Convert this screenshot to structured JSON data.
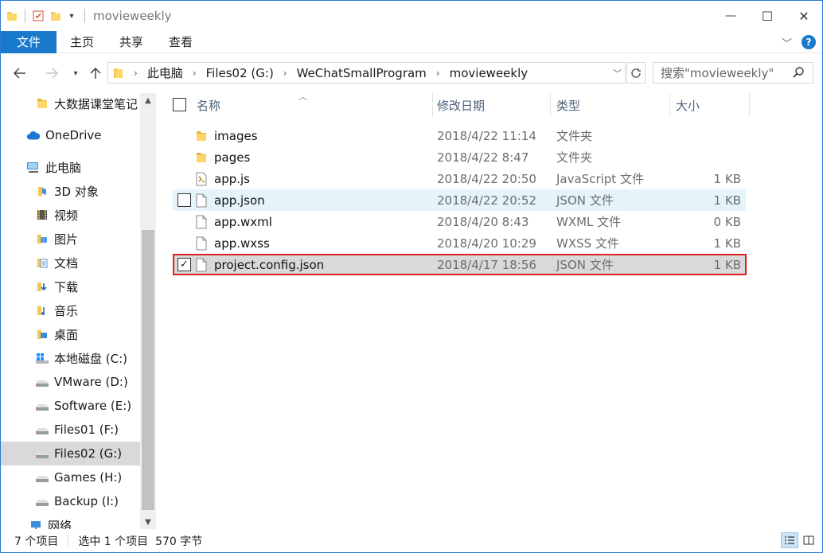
{
  "window": {
    "title": "movieweekly",
    "controls": {
      "minimize": "—",
      "maximize": "☐",
      "close": "✕"
    }
  },
  "ribbon": {
    "file_tab": "文件",
    "tabs": [
      "主页",
      "共享",
      "查看"
    ]
  },
  "address": {
    "breadcrumbs": [
      "此电脑",
      "Files02 (G:)",
      "WeChatSmallProgram",
      "movieweekly"
    ],
    "search_placeholder": "搜索\"movieweekly\""
  },
  "nav": {
    "items": [
      {
        "label": "大数据课堂笔记",
        "icon": "folder-icon"
      },
      {
        "label": "OneDrive",
        "icon": "cloud-icon"
      },
      {
        "label": "此电脑",
        "icon": "computer-icon"
      },
      {
        "label": "3D 对象",
        "icon": "3d-objects-icon"
      },
      {
        "label": "视频",
        "icon": "videos-icon"
      },
      {
        "label": "图片",
        "icon": "pictures-icon"
      },
      {
        "label": "文档",
        "icon": "documents-icon"
      },
      {
        "label": "下载",
        "icon": "downloads-icon"
      },
      {
        "label": "音乐",
        "icon": "music-icon"
      },
      {
        "label": "桌面",
        "icon": "desktop-icon"
      },
      {
        "label": "本地磁盘 (C:)",
        "icon": "windows-drive-icon"
      },
      {
        "label": "VMware (D:)",
        "icon": "drive-icon"
      },
      {
        "label": "Software (E:)",
        "icon": "drive-icon"
      },
      {
        "label": "Files01 (F:)",
        "icon": "drive-icon"
      },
      {
        "label": "Files02 (G:)",
        "icon": "drive-icon",
        "selected": true
      },
      {
        "label": "Games (H:)",
        "icon": "drive-icon"
      },
      {
        "label": "Backup (I:)",
        "icon": "drive-icon"
      },
      {
        "label": "网络",
        "icon": "network-icon"
      }
    ]
  },
  "columns": {
    "name": "名称",
    "date": "修改日期",
    "type": "类型",
    "size": "大小"
  },
  "files": [
    {
      "name": "images",
      "date": "2018/4/22 11:14",
      "type": "文件夹",
      "size": "",
      "icon": "folder-icon"
    },
    {
      "name": "pages",
      "date": "2018/4/22 8:47",
      "type": "文件夹",
      "size": "",
      "icon": "folder-icon"
    },
    {
      "name": "app.js",
      "date": "2018/4/22 20:50",
      "type": "JavaScript 文件",
      "size": "1 KB",
      "icon": "js-file-icon"
    },
    {
      "name": "app.json",
      "date": "2018/4/22 20:52",
      "type": "JSON 文件",
      "size": "1 KB",
      "icon": "file-icon",
      "state": "hover"
    },
    {
      "name": "app.wxml",
      "date": "2018/4/20 8:43",
      "type": "WXML 文件",
      "size": "0 KB",
      "icon": "file-icon"
    },
    {
      "name": "app.wxss",
      "date": "2018/4/20 10:29",
      "type": "WXSS 文件",
      "size": "1 KB",
      "icon": "file-icon"
    },
    {
      "name": "project.config.json",
      "date": "2018/4/17 18:56",
      "type": "JSON 文件",
      "size": "1 KB",
      "icon": "file-icon",
      "state": "selected",
      "checked": true
    }
  ],
  "status": {
    "item_count": "7 个项目",
    "selection": "选中 1 个项目  570 字节"
  },
  "colors": {
    "accent": "#1979ca",
    "highlight_border": "#e02020",
    "selected_row": "#d9d9d9",
    "hover_row": "#e5f3fb"
  }
}
